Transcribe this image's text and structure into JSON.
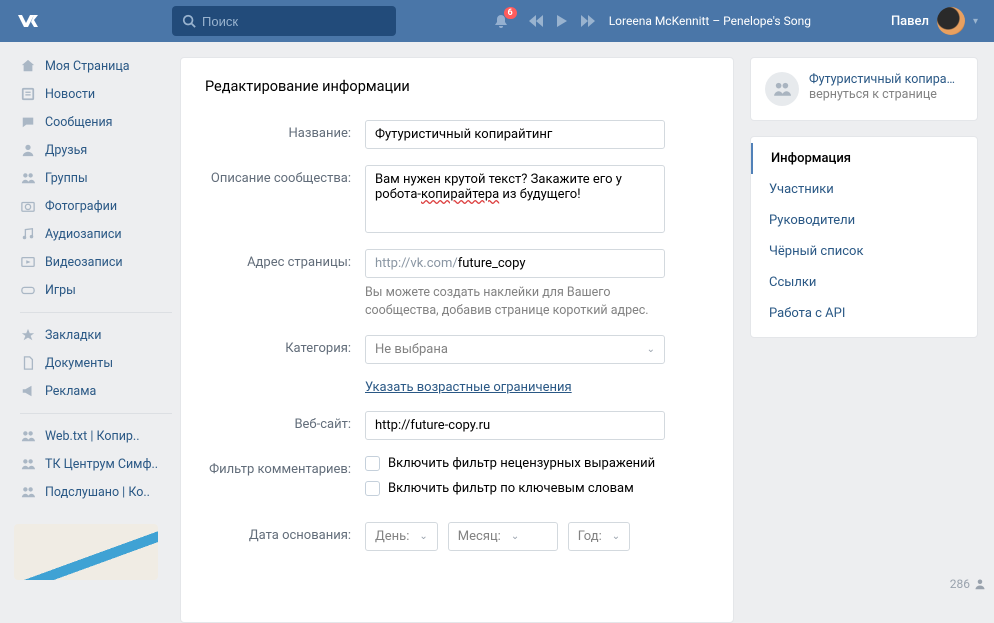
{
  "header": {
    "search_placeholder": "Поиск",
    "notif_count": "6",
    "track": "Loreena McKennitt – Penelope's Song",
    "user_name": "Павел"
  },
  "sidebar": {
    "items": [
      {
        "label": "Моя Страница"
      },
      {
        "label": "Новости"
      },
      {
        "label": "Сообщения"
      },
      {
        "label": "Друзья"
      },
      {
        "label": "Группы"
      },
      {
        "label": "Фотографии"
      },
      {
        "label": "Аудиозаписи"
      },
      {
        "label": "Видеозаписи"
      },
      {
        "label": "Игры"
      }
    ],
    "items2": [
      {
        "label": "Закладки"
      },
      {
        "label": "Документы"
      },
      {
        "label": "Реклама"
      }
    ],
    "items3": [
      {
        "label": "Web.txt | Копир.."
      },
      {
        "label": "ТК Центрум Симф.."
      },
      {
        "label": "Подслушано | Ко.."
      }
    ]
  },
  "main": {
    "title": "Редактирование информации",
    "labels": {
      "name": "Название:",
      "description": "Описание сообщества:",
      "url": "Адрес страницы:",
      "category": "Категория:",
      "website": "Веб-сайт:",
      "filter": "Фильтр комментариев:",
      "founded": "Дата основания:"
    },
    "values": {
      "name": "Футуристичный копирайтинг",
      "url_prefix": "http://vk.com/",
      "url_slug": "future_copy",
      "url_hint": "Вы можете создать наклейки для Вашего сообщества, добавив странице короткий адрес.",
      "category": "Не выбрана",
      "age_link": "Указать возрастные ограничения",
      "website": "http://future-copy.ru",
      "filter1": "Включить фильтр нецензурных выражений",
      "filter2": "Включить фильтр по ключевым словам",
      "day": "День:",
      "month": "Месяц:",
      "year": "Год:"
    }
  },
  "right": {
    "community": "Футуристичный копирай...",
    "back": "вернуться к странице",
    "tabs": [
      {
        "label": "Информация",
        "active": true
      },
      {
        "label": "Участники"
      },
      {
        "label": "Руководители"
      },
      {
        "label": "Чёрный список"
      },
      {
        "label": "Ссылки"
      },
      {
        "label": "Работа с API"
      }
    ]
  },
  "online": "286"
}
